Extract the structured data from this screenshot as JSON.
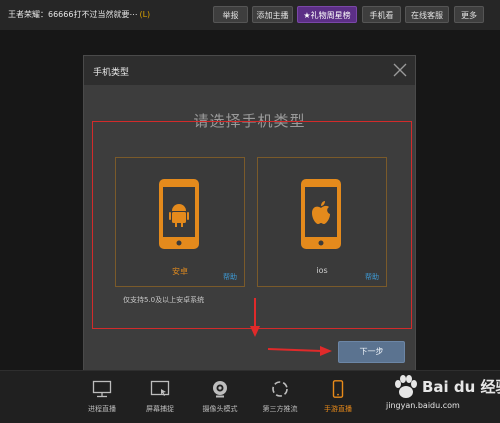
{
  "header": {
    "stream_title": "王者荣耀：66666打不过当然就要⋯",
    "level_badge": "(L)",
    "buttons": [
      "举报",
      "添加主播",
      "礼物周星榜",
      "手机看",
      "在线客服",
      "更多"
    ]
  },
  "dialog": {
    "title": "手机类型",
    "heading": "请选择手机类型",
    "options": [
      {
        "label": "安卓",
        "help": "帮助",
        "os_icon": "android-icon"
      },
      {
        "label": "ios",
        "help": "帮助",
        "os_icon": "apple-icon"
      }
    ],
    "support_note": "仅支持5.0及以上安卓系统",
    "next_label": "下一步",
    "accent_color": "#e08a1e"
  },
  "bottom_nav": {
    "items": [
      {
        "label": "进程直播",
        "icon": "monitor-icon"
      },
      {
        "label": "屏幕捕捉",
        "icon": "screen-capture-icon"
      },
      {
        "label": "摄像头模式",
        "icon": "webcam-icon"
      },
      {
        "label": "第三方推流",
        "icon": "stream-icon"
      },
      {
        "label": "手游直播",
        "icon": "phone-icon",
        "active": true
      }
    ]
  },
  "watermark": {
    "brand": "Bai du 经验",
    "url": "jingyan.baidu.com"
  }
}
